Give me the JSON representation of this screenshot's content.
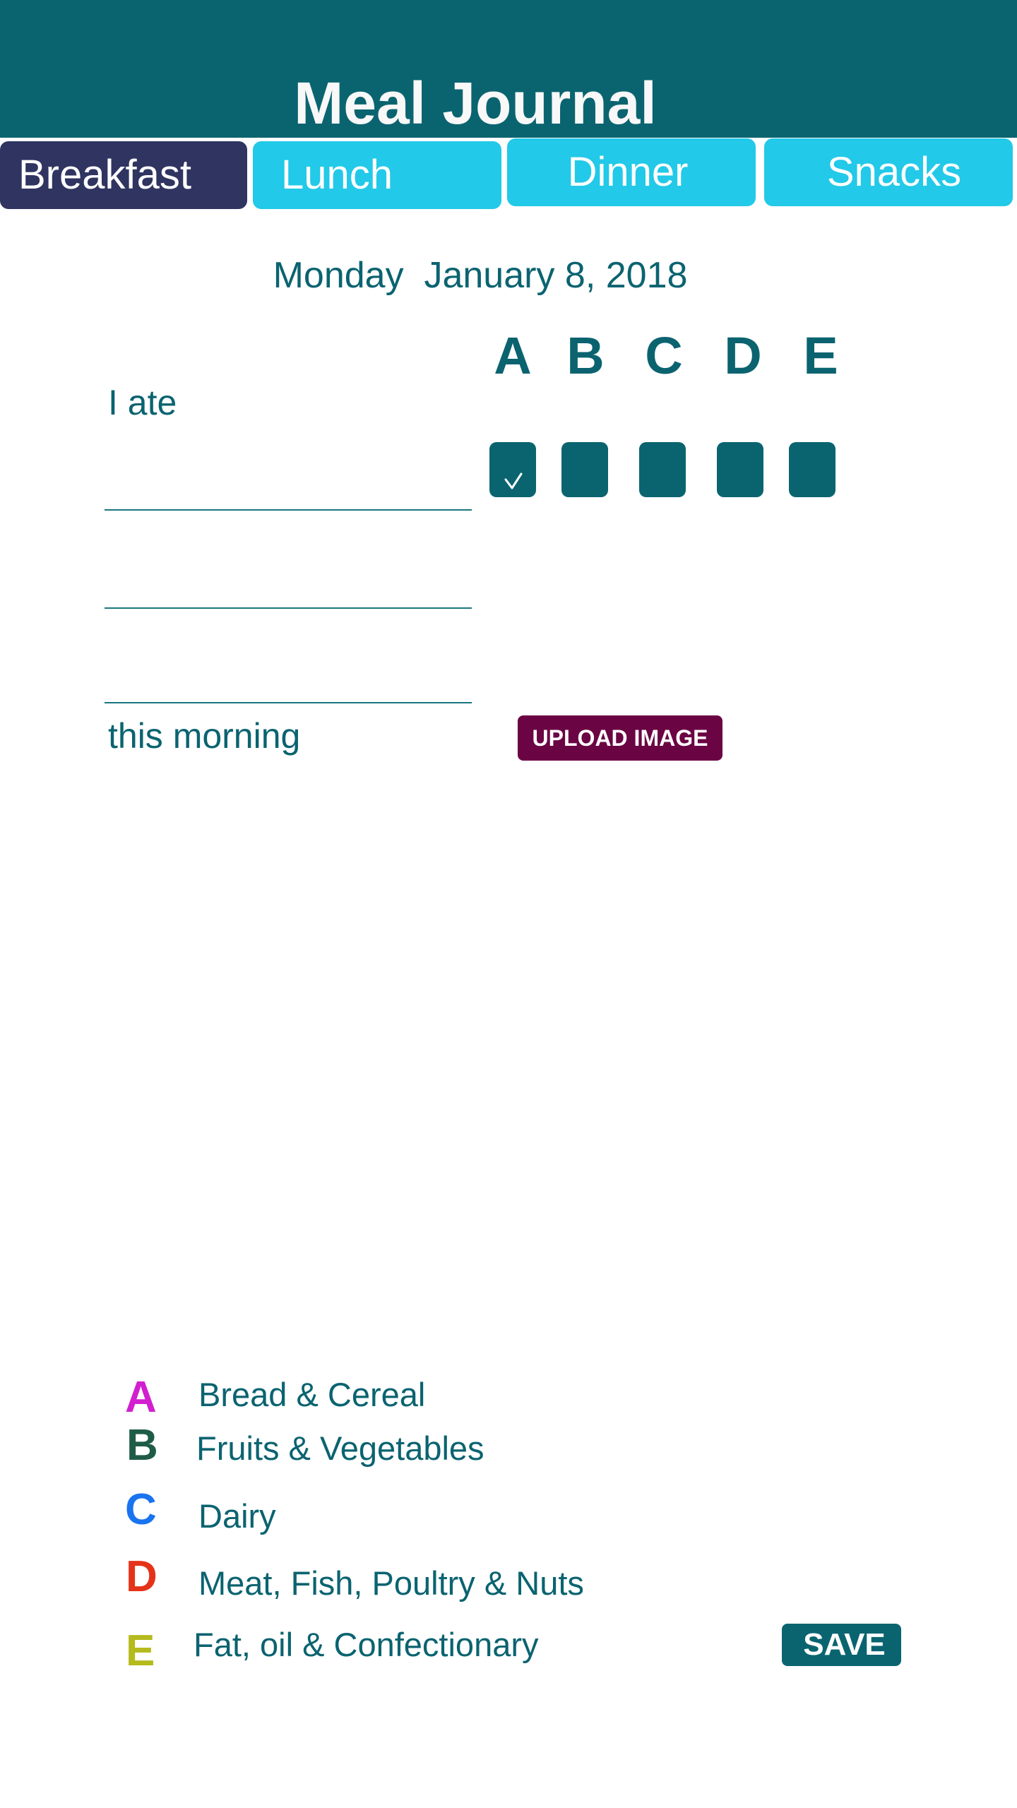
{
  "header": {
    "title": "Meal Journal"
  },
  "tabs": [
    {
      "label": "Breakfast",
      "active": true
    },
    {
      "label": "Lunch",
      "active": false
    },
    {
      "label": "Dinner",
      "active": false
    },
    {
      "label": "Snacks",
      "active": false
    }
  ],
  "date": {
    "weekday": "Monday",
    "full_date": "January 8, 2018",
    "display": "Monday  January 8, 2018"
  },
  "entry": {
    "prefix_label": "I ate",
    "suffix_label": "this morning",
    "lines": [
      {
        "value": "",
        "placeholder": ""
      },
      {
        "value": "",
        "placeholder": ""
      },
      {
        "value": "",
        "placeholder": ""
      }
    ]
  },
  "food_groups": {
    "columns": [
      "A",
      "B",
      "C",
      "D",
      "E"
    ],
    "checked": [
      true,
      false,
      false,
      false,
      false
    ],
    "check_icon": "checkmark-icon"
  },
  "upload_button": {
    "label": "UPLOAD IMAGE"
  },
  "legend": [
    {
      "letter": "A",
      "label": "Bread & Cereal",
      "color": "#d21fcf"
    },
    {
      "letter": "B",
      "label": "Fruits & Vegetables",
      "color": "#1f5c48"
    },
    {
      "letter": "C",
      "label": "Dairy",
      "color": "#1a73ef"
    },
    {
      "letter": "D",
      "label": "Meat, Fish, Poultry & Nuts",
      "color": "#e5331a"
    },
    {
      "letter": "E",
      "label": "Fat, oil & Confectionary",
      "color": "#b5ba1d"
    }
  ],
  "save_button": {
    "label": "SAVE"
  },
  "colors": {
    "primary": "#0a6470",
    "tab": "#22c9e8",
    "tab_active": "#2f3461",
    "upload": "#6b0443",
    "text": "#0b6370"
  }
}
